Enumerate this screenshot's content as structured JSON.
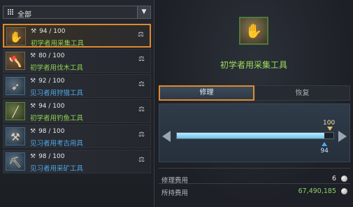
{
  "filter": {
    "label": "全部",
    "dropdown_glyph": "▼"
  },
  "items": [
    {
      "durability": "94 / 100",
      "name": "初学者用采集工具",
      "name_color": "green",
      "icon": "gathering-gloves-icon",
      "icon_glyph": "✋",
      "selected": true
    },
    {
      "durability": "80 / 100",
      "name": "初学者用伐木工具",
      "name_color": "green",
      "icon": "axe-icon",
      "icon_glyph": "🪓",
      "selected": false
    },
    {
      "durability": "92 / 100",
      "name": "见习者用狩猎工具",
      "name_color": "blue",
      "icon": "hunting-tool-icon",
      "icon_glyph": "➶",
      "selected": false
    },
    {
      "durability": "94 / 100",
      "name": "初学者用钓鱼工具",
      "name_color": "green",
      "icon": "fishing-rod-icon",
      "icon_glyph": "╱",
      "selected": false
    },
    {
      "durability": "98 / 100",
      "name": "见习者用考古用具",
      "name_color": "blue",
      "icon": "shovel-icon",
      "icon_glyph": "⚒",
      "selected": false
    },
    {
      "durability": "98 / 100",
      "name": "见习者用采矿工具",
      "name_color": "blue",
      "icon": "pickaxe-icon",
      "icon_glyph": "⛏",
      "selected": false
    }
  ],
  "detail": {
    "title": "初学者用采集工具",
    "icon_glyph": "✋",
    "tabs": [
      {
        "label": "修理",
        "active": true
      },
      {
        "label": "恢复",
        "active": false
      }
    ],
    "durability": {
      "current": 94,
      "max": 100,
      "current_label": "94",
      "max_label": "100"
    },
    "repair_cost": {
      "label": "修理费用",
      "value": "6"
    },
    "owned_money": {
      "label": "所持费用",
      "value": "67,490,185"
    }
  },
  "colors": {
    "accent": "#e0892e",
    "green_name": "#8fd14f",
    "blue_name": "#4ea7e6",
    "bar_fill": "#8fd6f4"
  }
}
